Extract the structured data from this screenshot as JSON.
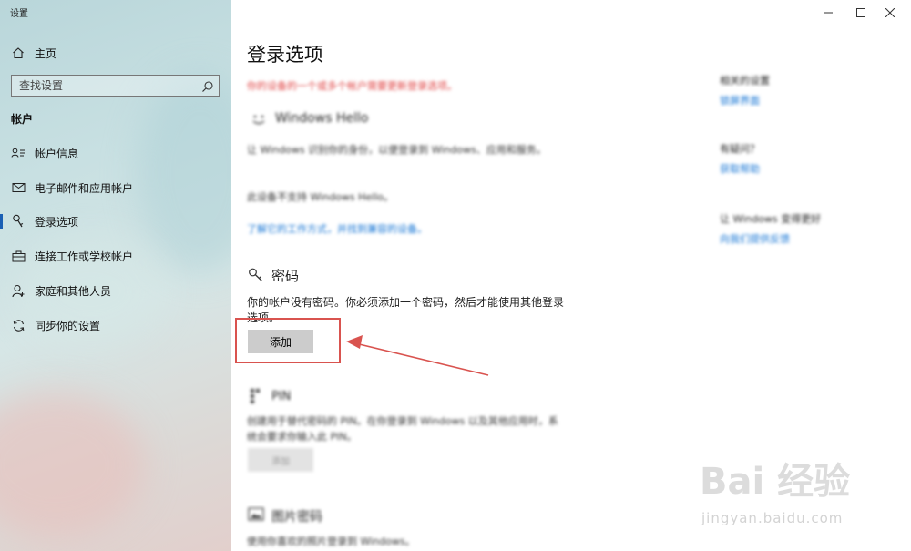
{
  "window": {
    "title": "设置",
    "controls": [
      "minimize-icon",
      "maximize-icon",
      "close-icon"
    ]
  },
  "sidebar": {
    "home": "主页",
    "search_placeholder": "查找设置",
    "section": "帐户",
    "items": [
      {
        "label": "帐户信息",
        "icon": "person-card-icon"
      },
      {
        "label": "电子邮件和应用帐户",
        "icon": "mail-icon"
      },
      {
        "label": "登录选项",
        "icon": "key-icon",
        "selected": true
      },
      {
        "label": "连接工作或学校帐户",
        "icon": "briefcase-icon"
      },
      {
        "label": "家庭和其他人员",
        "icon": "people-icon"
      },
      {
        "label": "同步你的设置",
        "icon": "sync-icon"
      }
    ]
  },
  "main": {
    "title": "登录选项",
    "warning": "你的设备的一个或多个帐户需要更新登录选项。",
    "hello": {
      "title": "Windows Hello",
      "desc": "让 Windows 识别你的身份，以便登录到 Windows、应用和服务。",
      "unsupported": "此设备不支持 Windows Hello。",
      "link": "了解它的工作方式，并找到兼容的设备。"
    },
    "password": {
      "title": "密码",
      "desc": "你的帐户没有密码。你必须添加一个密码，然后才能使用其他登录选项。",
      "button": "添加"
    },
    "pin": {
      "title": "PIN",
      "desc": "创建用于替代密码的 PIN。在你登录到 Windows 以及其他应用时，系统会要求你输入此 PIN。",
      "button": "添加"
    },
    "picture": {
      "title": "图片密码",
      "desc": "使用你喜欢的照片登录到 Windows。"
    }
  },
  "related": {
    "heading": "相关的设置",
    "link": "锁屏界面",
    "question": "有疑问？",
    "help": "获取帮助",
    "improve": "让 Windows 变得更好",
    "feedback": "向我们提供反馈"
  },
  "watermark": {
    "brand": "Bai 经验",
    "url": "jingyan.baidu.com"
  },
  "colors": {
    "accent": "#1474d4",
    "annotation": "#d9534f",
    "warning": "#e04646"
  }
}
